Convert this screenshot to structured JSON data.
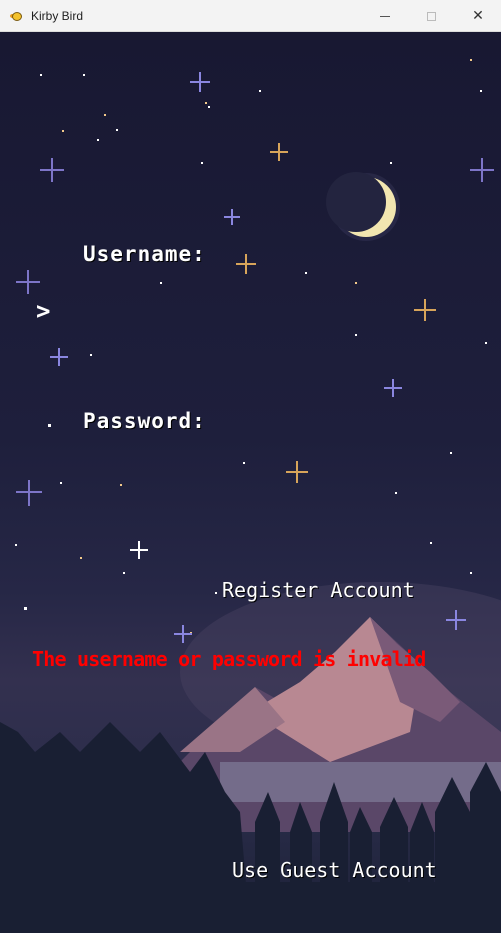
{
  "window": {
    "title": "Kirby Bird",
    "app_icon": "kirby-bird-icon",
    "controls": [
      "minimize-icon",
      "maximize-icon",
      "close-icon"
    ]
  },
  "login": {
    "username_label": "Username:",
    "prompt_cursor": ">",
    "password_label": "Password:",
    "register_label": "Register Account",
    "error_message": "The username or password is invalid",
    "guest_label": "Use Guest Account"
  },
  "colors": {
    "error": "#ff0000",
    "text": "#ffffff",
    "sky": "#1e1f3c",
    "moon": "#f2e6b0"
  }
}
